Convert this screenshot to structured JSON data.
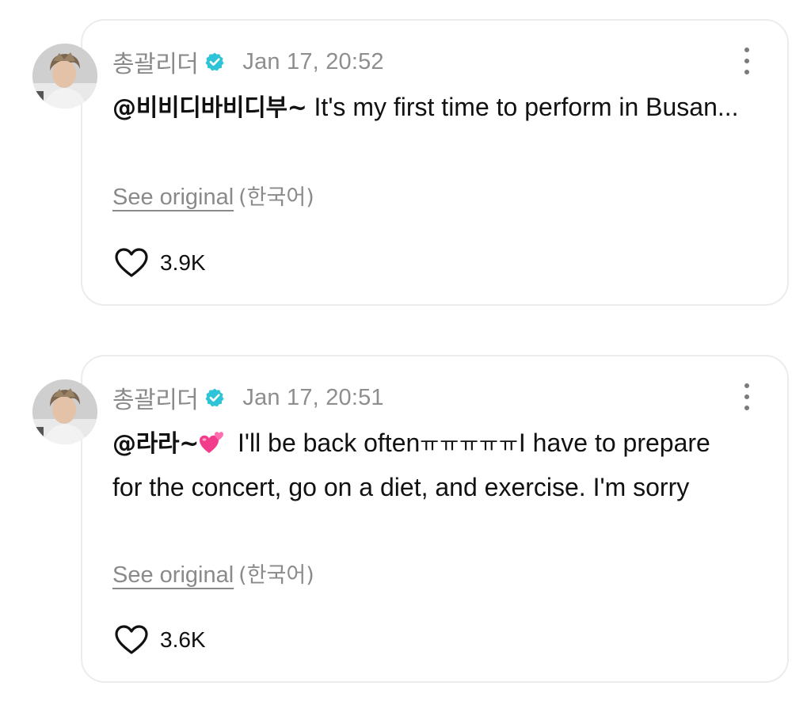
{
  "colors": {
    "verified_badge": "#2cc4d6",
    "muted_text": "#8a8a8a",
    "card_border": "#ececec"
  },
  "comments": [
    {
      "author": "총괄리더",
      "verified_icon": "verified-badge-icon",
      "timestamp": "Jan 17, 20:52",
      "mention": "@비비디바비디부~",
      "text": "It's my first time to perform in Busan...",
      "see_original_label": "See original",
      "original_language": "(한국어)",
      "likes": "3.9K"
    },
    {
      "author": "총괄리더",
      "verified_icon": "verified-badge-icon",
      "timestamp": "Jan 17, 20:51",
      "mention": "@라라~",
      "emoji": "two-hearts-emoji",
      "text_start": "I'll be back often",
      "text_korean": "ㅠㅠㅠㅠㅠ",
      "text_rest": "I have to prepare for the concert, go on a diet, and exercise. I'm sorry",
      "see_original_label": "See original",
      "original_language": "(한국어)",
      "likes": "3.6K"
    }
  ]
}
